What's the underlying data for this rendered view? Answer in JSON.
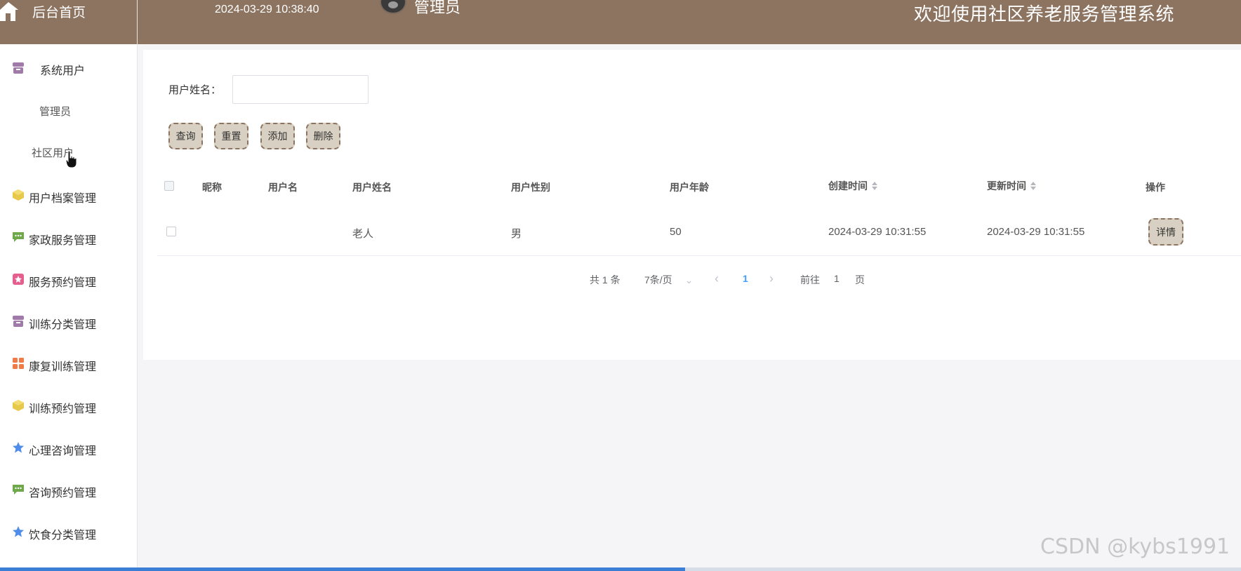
{
  "header": {
    "home_label": "后台首页",
    "datetime": "2024-03-29 10:38:40",
    "user_name": "管理员",
    "title": "欢迎使用社区养老服务管理系统",
    "color": "#8d7461"
  },
  "sidebar": {
    "items": [
      {
        "label": "系统用户",
        "icon": "archive-icon",
        "color": "#a07aa8"
      },
      {
        "label": "用户档案管理",
        "icon": "cube-icon",
        "color": "#e6c84a"
      },
      {
        "label": "家政服务管理",
        "icon": "chat-icon",
        "color": "#6fa84a"
      },
      {
        "label": "服务预约管理",
        "icon": "gift-icon",
        "color": "#e45f8e"
      },
      {
        "label": "训练分类管理",
        "icon": "archive-icon",
        "color": "#a07aa8"
      },
      {
        "label": "康复训练管理",
        "icon": "grid-icon",
        "color": "#f07b46"
      },
      {
        "label": "训练预约管理",
        "icon": "cube-icon",
        "color": "#e6c84a"
      },
      {
        "label": "心理咨询管理",
        "icon": "star-icon",
        "color": "#4f8de8"
      },
      {
        "label": "咨询预约管理",
        "icon": "chat-icon",
        "color": "#6fa84a"
      },
      {
        "label": "饮食分类管理",
        "icon": "star-icon",
        "color": "#4f8de8"
      }
    ],
    "submenu": [
      "管理员",
      "社区用户"
    ]
  },
  "search": {
    "label": "用户姓名：",
    "value": "",
    "placeholder": ""
  },
  "toolbar": {
    "query_label": "查询",
    "reset_label": "重置",
    "add_label": "添加",
    "delete_label": "删除"
  },
  "table": {
    "columns": [
      "昵称",
      "用户名",
      "用户姓名",
      "用户性别",
      "用户年龄",
      "创建时间",
      "更新时间",
      "操作"
    ],
    "rows": [
      {
        "nickname": "",
        "username": "",
        "realname": "老人",
        "gender": "男",
        "age": "50",
        "created": "2024-03-29 10:31:55",
        "updated": "2024-03-29 10:31:55",
        "action": "详情"
      }
    ]
  },
  "pagination": {
    "total": "共 1 条",
    "page_size": "7条/页",
    "current_page": "1",
    "goto_label": "前往",
    "goto_value": "1",
    "page_suffix": "页"
  },
  "watermark": "CSDN @kybs1991"
}
